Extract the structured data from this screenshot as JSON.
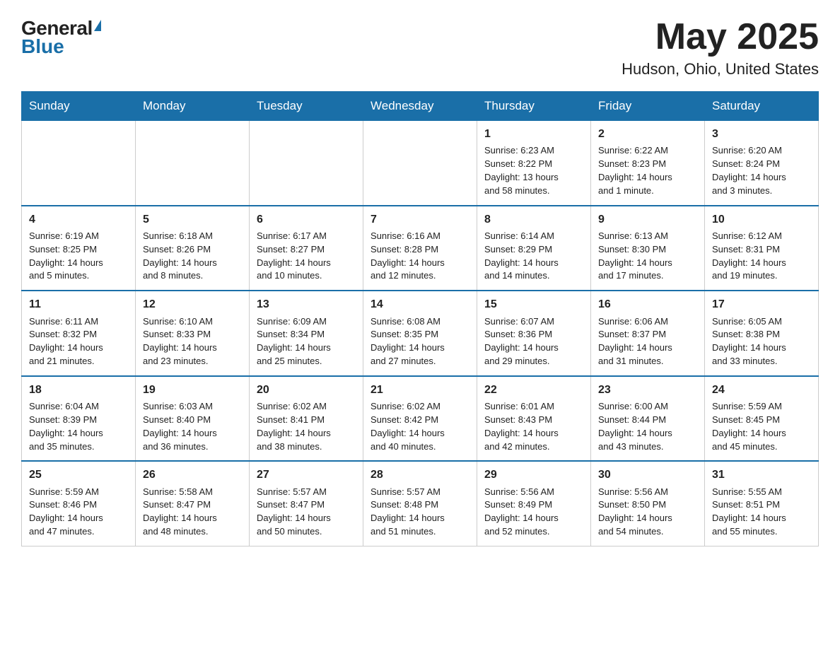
{
  "header": {
    "logo_general": "General",
    "logo_blue": "Blue",
    "month_title": "May 2025",
    "location": "Hudson, Ohio, United States"
  },
  "weekdays": [
    "Sunday",
    "Monday",
    "Tuesday",
    "Wednesday",
    "Thursday",
    "Friday",
    "Saturday"
  ],
  "weeks": [
    [
      {
        "day": "",
        "info": ""
      },
      {
        "day": "",
        "info": ""
      },
      {
        "day": "",
        "info": ""
      },
      {
        "day": "",
        "info": ""
      },
      {
        "day": "1",
        "info": "Sunrise: 6:23 AM\nSunset: 8:22 PM\nDaylight: 13 hours\nand 58 minutes."
      },
      {
        "day": "2",
        "info": "Sunrise: 6:22 AM\nSunset: 8:23 PM\nDaylight: 14 hours\nand 1 minute."
      },
      {
        "day": "3",
        "info": "Sunrise: 6:20 AM\nSunset: 8:24 PM\nDaylight: 14 hours\nand 3 minutes."
      }
    ],
    [
      {
        "day": "4",
        "info": "Sunrise: 6:19 AM\nSunset: 8:25 PM\nDaylight: 14 hours\nand 5 minutes."
      },
      {
        "day": "5",
        "info": "Sunrise: 6:18 AM\nSunset: 8:26 PM\nDaylight: 14 hours\nand 8 minutes."
      },
      {
        "day": "6",
        "info": "Sunrise: 6:17 AM\nSunset: 8:27 PM\nDaylight: 14 hours\nand 10 minutes."
      },
      {
        "day": "7",
        "info": "Sunrise: 6:16 AM\nSunset: 8:28 PM\nDaylight: 14 hours\nand 12 minutes."
      },
      {
        "day": "8",
        "info": "Sunrise: 6:14 AM\nSunset: 8:29 PM\nDaylight: 14 hours\nand 14 minutes."
      },
      {
        "day": "9",
        "info": "Sunrise: 6:13 AM\nSunset: 8:30 PM\nDaylight: 14 hours\nand 17 minutes."
      },
      {
        "day": "10",
        "info": "Sunrise: 6:12 AM\nSunset: 8:31 PM\nDaylight: 14 hours\nand 19 minutes."
      }
    ],
    [
      {
        "day": "11",
        "info": "Sunrise: 6:11 AM\nSunset: 8:32 PM\nDaylight: 14 hours\nand 21 minutes."
      },
      {
        "day": "12",
        "info": "Sunrise: 6:10 AM\nSunset: 8:33 PM\nDaylight: 14 hours\nand 23 minutes."
      },
      {
        "day": "13",
        "info": "Sunrise: 6:09 AM\nSunset: 8:34 PM\nDaylight: 14 hours\nand 25 minutes."
      },
      {
        "day": "14",
        "info": "Sunrise: 6:08 AM\nSunset: 8:35 PM\nDaylight: 14 hours\nand 27 minutes."
      },
      {
        "day": "15",
        "info": "Sunrise: 6:07 AM\nSunset: 8:36 PM\nDaylight: 14 hours\nand 29 minutes."
      },
      {
        "day": "16",
        "info": "Sunrise: 6:06 AM\nSunset: 8:37 PM\nDaylight: 14 hours\nand 31 minutes."
      },
      {
        "day": "17",
        "info": "Sunrise: 6:05 AM\nSunset: 8:38 PM\nDaylight: 14 hours\nand 33 minutes."
      }
    ],
    [
      {
        "day": "18",
        "info": "Sunrise: 6:04 AM\nSunset: 8:39 PM\nDaylight: 14 hours\nand 35 minutes."
      },
      {
        "day": "19",
        "info": "Sunrise: 6:03 AM\nSunset: 8:40 PM\nDaylight: 14 hours\nand 36 minutes."
      },
      {
        "day": "20",
        "info": "Sunrise: 6:02 AM\nSunset: 8:41 PM\nDaylight: 14 hours\nand 38 minutes."
      },
      {
        "day": "21",
        "info": "Sunrise: 6:02 AM\nSunset: 8:42 PM\nDaylight: 14 hours\nand 40 minutes."
      },
      {
        "day": "22",
        "info": "Sunrise: 6:01 AM\nSunset: 8:43 PM\nDaylight: 14 hours\nand 42 minutes."
      },
      {
        "day": "23",
        "info": "Sunrise: 6:00 AM\nSunset: 8:44 PM\nDaylight: 14 hours\nand 43 minutes."
      },
      {
        "day": "24",
        "info": "Sunrise: 5:59 AM\nSunset: 8:45 PM\nDaylight: 14 hours\nand 45 minutes."
      }
    ],
    [
      {
        "day": "25",
        "info": "Sunrise: 5:59 AM\nSunset: 8:46 PM\nDaylight: 14 hours\nand 47 minutes."
      },
      {
        "day": "26",
        "info": "Sunrise: 5:58 AM\nSunset: 8:47 PM\nDaylight: 14 hours\nand 48 minutes."
      },
      {
        "day": "27",
        "info": "Sunrise: 5:57 AM\nSunset: 8:47 PM\nDaylight: 14 hours\nand 50 minutes."
      },
      {
        "day": "28",
        "info": "Sunrise: 5:57 AM\nSunset: 8:48 PM\nDaylight: 14 hours\nand 51 minutes."
      },
      {
        "day": "29",
        "info": "Sunrise: 5:56 AM\nSunset: 8:49 PM\nDaylight: 14 hours\nand 52 minutes."
      },
      {
        "day": "30",
        "info": "Sunrise: 5:56 AM\nSunset: 8:50 PM\nDaylight: 14 hours\nand 54 minutes."
      },
      {
        "day": "31",
        "info": "Sunrise: 5:55 AM\nSunset: 8:51 PM\nDaylight: 14 hours\nand 55 minutes."
      }
    ]
  ]
}
